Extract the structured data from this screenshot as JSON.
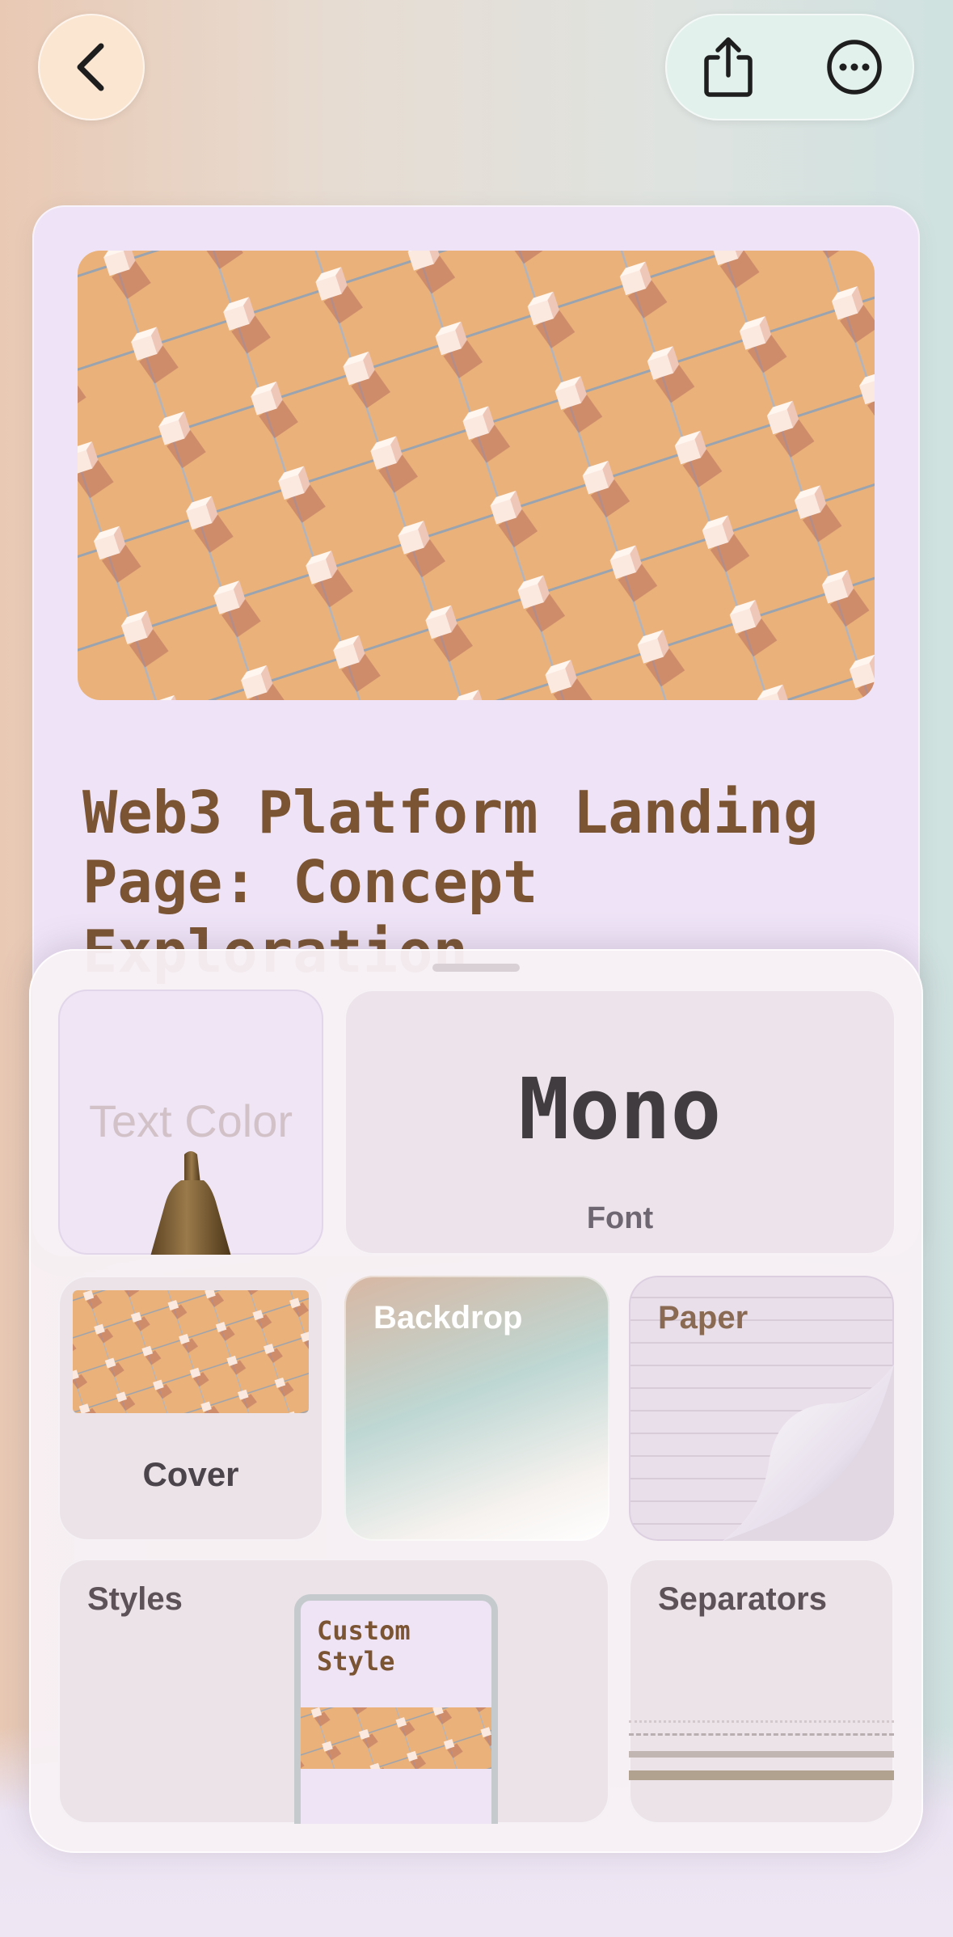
{
  "nav": {
    "back_icon": "chevron-left-icon",
    "share_icon": "share-icon",
    "more_icon": "ellipsis-circle-icon"
  },
  "card": {
    "title": "Web3 Platform Landing Page: Concept Exploration",
    "cover_description": "orange isometric grid of white cubes connected by rods"
  },
  "sheet": {
    "text_color": {
      "label": "Text Color",
      "icon": "marker-pen-icon",
      "pen_color": "#7a5a32"
    },
    "font": {
      "name": "Mono",
      "label": "Font"
    },
    "cover": {
      "label": "Cover"
    },
    "backdrop": {
      "label": "Backdrop"
    },
    "paper": {
      "label": "Paper"
    },
    "styles": {
      "label": "Styles",
      "card_label": "Custom Style"
    },
    "separators": {
      "label": "Separators"
    }
  },
  "colors": {
    "title": "#7b5533",
    "cover_orange": "#eab27a",
    "card_background": "#efe4f7"
  }
}
